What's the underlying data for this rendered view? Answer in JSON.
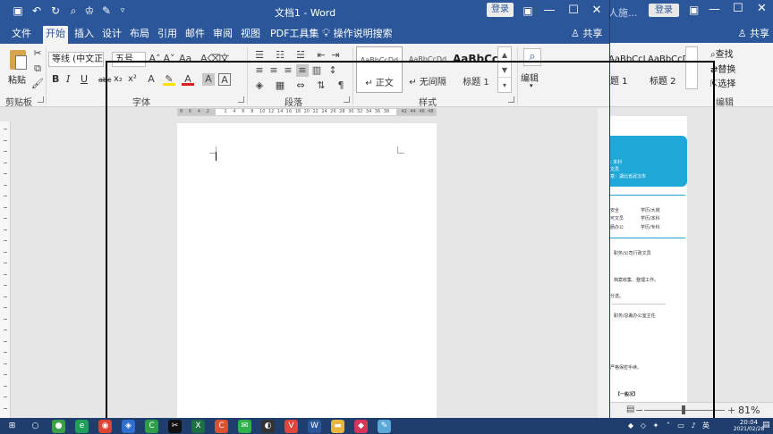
{
  "window": {
    "title": "文档1  -  Word",
    "login_label": "登录",
    "share_label": "共享",
    "quick_access": [
      "save-icon",
      "undo-icon",
      "redo-icon",
      "print-preview-icon",
      "org-chart-icon",
      "format-painter-icon",
      "customize-icon"
    ],
    "controls": [
      "ribbon-display-icon",
      "minimize-icon",
      "maximize-icon",
      "close-icon"
    ]
  },
  "tabs": [
    {
      "label": "文件",
      "active": false
    },
    {
      "label": "开始",
      "active": true
    },
    {
      "label": "插入",
      "active": false
    },
    {
      "label": "设计",
      "active": false
    },
    {
      "label": "布局",
      "active": false
    },
    {
      "label": "引用",
      "active": false
    },
    {
      "label": "邮件",
      "active": false
    },
    {
      "label": "审阅",
      "active": false
    },
    {
      "label": "视图",
      "active": false
    },
    {
      "label": "PDF工具集",
      "active": false
    }
  ],
  "tell_me": "操作说明搜索",
  "ribbon": {
    "clipboard": {
      "paste_label": "粘贴",
      "group_label": "剪贴板"
    },
    "font": {
      "font_name": "等线 (中文正文)",
      "font_size": "五号",
      "bold": "B",
      "italic": "I",
      "underline": "U",
      "strike": "abc",
      "subscript": "x₂",
      "superscript": "x²",
      "group_label": "字体"
    },
    "paragraph": {
      "group_label": "段落"
    },
    "styles": {
      "items": [
        {
          "preview": "AaBbCcDd",
          "name": "↵ 正文",
          "selected": true,
          "big": false
        },
        {
          "preview": "AaBbCcDd",
          "name": "↵ 无间隔",
          "selected": false,
          "big": false
        },
        {
          "preview": "AaBbCcI",
          "name": "标题 1",
          "selected": false,
          "big": true
        }
      ],
      "group_label": "样式"
    },
    "editing": {
      "label": "编辑"
    }
  },
  "ruler_numbers": [
    "8",
    "6",
    "4",
    "2",
    "",
    "2",
    "4",
    "6",
    "8",
    "10",
    "12",
    "14",
    "16",
    "18",
    "20",
    "22",
    "24",
    "26",
    "28",
    "30",
    "32",
    "34",
    "36",
    "38",
    "",
    "42",
    "44",
    "46",
    "48"
  ],
  "background_window": {
    "title_fragment": "人施...",
    "login_label": "登录",
    "share_label": "共享",
    "styles": [
      {
        "preview": "AaBbCcI",
        "name": "题 1"
      },
      {
        "preview": "AaBbCcD",
        "name": "标题 2"
      }
    ],
    "editing": {
      "find": "查找",
      "replace": "替换",
      "select": "选择",
      "group_label": "编辑"
    },
    "zoom": "81%",
    "resume_banner": [
      ": 本科",
      "文员",
      "意：湖北省武汉市"
    ],
    "resume_lines": [
      "安全",
      "学历/大岗",
      "可文员",
      "学历/本科",
      "肠办公",
      "学历/专科",
      "职务/公司行政文员",
      "档案收集、整理工作。",
      "分送。",
      "职务/总裁办公室主任",
      "严格保密手续。",
      "【一般况】"
    ]
  },
  "taskbar": {
    "icons": [
      {
        "name": "start-icon",
        "color": "#1f3e6e",
        "glyph": "⊞"
      },
      {
        "name": "search-icon",
        "color": "#1f3e6e",
        "glyph": "○"
      },
      {
        "name": "app-green-icon",
        "color": "#3aa14a",
        "glyph": "●"
      },
      {
        "name": "browser-360-icon",
        "color": "#1fa05a",
        "glyph": "e"
      },
      {
        "name": "chrome-icon",
        "color": "#dd4433",
        "glyph": "◉"
      },
      {
        "name": "app-blue-icon",
        "color": "#2f6fd0",
        "glyph": "◈"
      },
      {
        "name": "camtasia-icon",
        "color": "#2e9e4a",
        "glyph": "C"
      },
      {
        "name": "capcut-icon",
        "color": "#111111",
        "glyph": "✂"
      },
      {
        "name": "excel-icon",
        "color": "#1d7044",
        "glyph": "X"
      },
      {
        "name": "app-red-icon",
        "color": "#e05030",
        "glyph": "C"
      },
      {
        "name": "wechat-icon",
        "color": "#2fb24c",
        "glyph": "✉"
      },
      {
        "name": "app-dark-icon",
        "color": "#333333",
        "glyph": "◐"
      },
      {
        "name": "vivaldi-icon",
        "color": "#e0453a",
        "glyph": "V"
      },
      {
        "name": "word-icon",
        "color": "#2b579a",
        "glyph": "W"
      },
      {
        "name": "folder-icon",
        "color": "#e8b63a",
        "glyph": "▬"
      },
      {
        "name": "app-pink-icon",
        "color": "#d8345a",
        "glyph": "◆"
      },
      {
        "name": "notepad-icon",
        "color": "#5aa8d8",
        "glyph": "✎"
      }
    ],
    "time": "20:04",
    "date": "2021/02/28"
  }
}
